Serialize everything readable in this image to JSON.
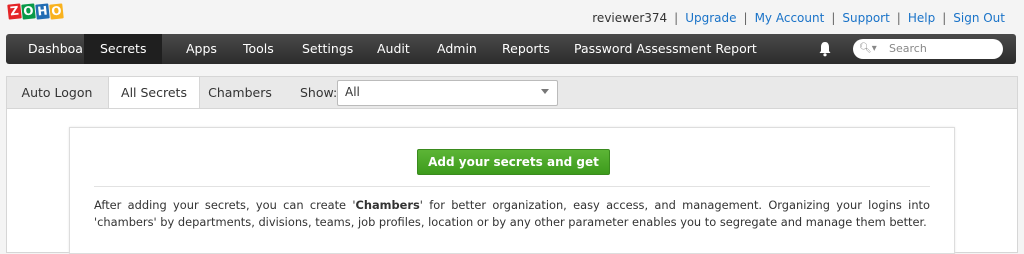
{
  "logo": {
    "letters": [
      "Z",
      "O",
      "H",
      "O"
    ],
    "colors": [
      "#e42527",
      "#089949",
      "#226db4",
      "#f9b21d"
    ]
  },
  "header": {
    "username": "reviewer374",
    "links": [
      "Upgrade",
      "My Account",
      "Support",
      "Help",
      "Sign Out"
    ],
    "link_color": "#1a73c8"
  },
  "nav": {
    "items": [
      "Dashboard",
      "Secrets",
      "Apps",
      "Tools",
      "Settings",
      "Audit",
      "Admin",
      "Reports",
      "Password Assessment Report"
    ],
    "active": "Secrets",
    "bell_icon": "bell-icon",
    "search": {
      "placeholder": "Search",
      "icon": "search-icon"
    }
  },
  "subnav": {
    "tabs": [
      "Auto Logon",
      "All Secrets",
      "Chambers"
    ],
    "active": "All Secrets",
    "show_label": "Show:",
    "show_value": "All"
  },
  "main": {
    "cta_label": "Add your secrets and get started!",
    "cta_color": "#4caf2a",
    "description_prefix": "After adding your secrets, you can create '",
    "description_bold": "Chambers",
    "description_suffix": "' for better organization, easy access, and management. Organizing your logins into 'chambers' by departments, divisions, teams, job profiles, location or by any other parameter enables you to segregate and manage them better."
  }
}
